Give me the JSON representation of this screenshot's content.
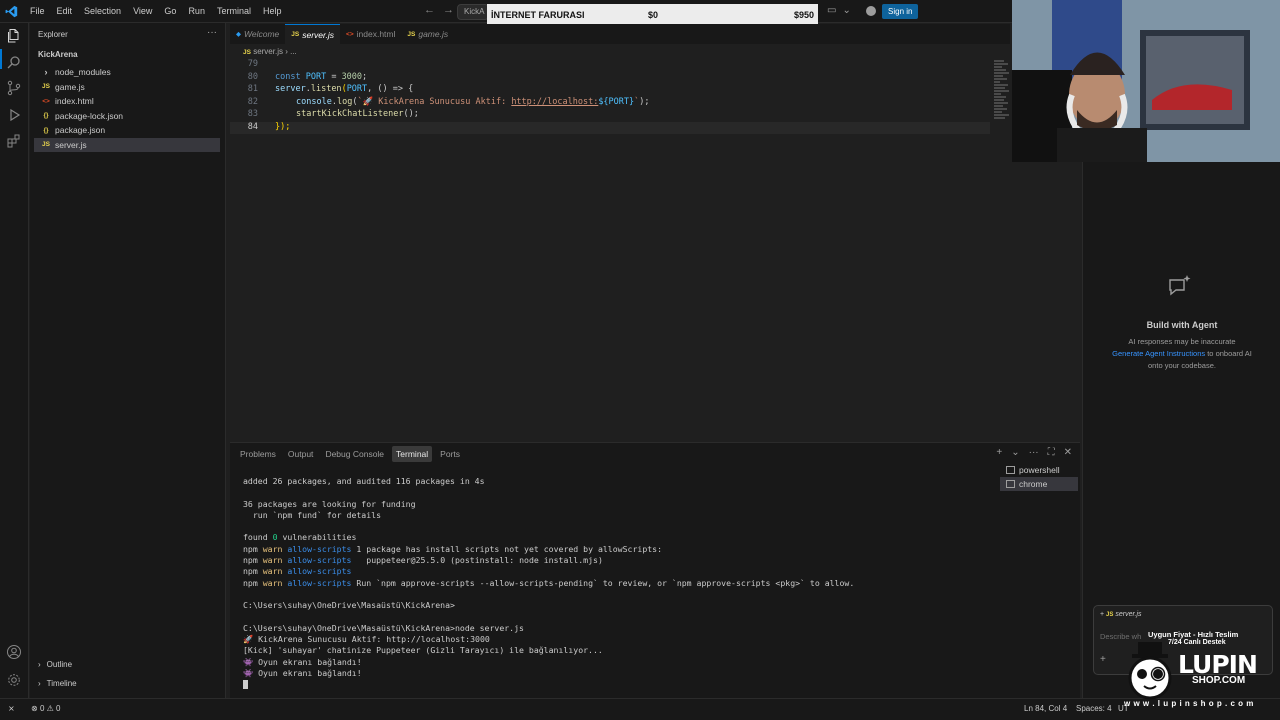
{
  "menu": [
    "File",
    "Edit",
    "Selection",
    "View",
    "Go",
    "Run",
    "Terminal",
    "Help"
  ],
  "command_center": "KickA",
  "overlay": {
    "label": "İNTERNET FARURASI",
    "current": "$0",
    "goal": "$950"
  },
  "signin_label": "Sign in",
  "sidebar": {
    "title": "Explorer",
    "folder": "KickArena",
    "items": [
      {
        "label": "node_modules",
        "icon": "chevron",
        "color": "#cccccc"
      },
      {
        "label": "game.js",
        "icon": "JS",
        "color": "#e8d44d"
      },
      {
        "label": "index.html",
        "icon": "<>",
        "color": "#e44d26"
      },
      {
        "label": "package-lock.json",
        "icon": "{}",
        "color": "#e8d44d"
      },
      {
        "label": "package.json",
        "icon": "{}",
        "color": "#e8d44d"
      },
      {
        "label": "server.js",
        "icon": "JS",
        "color": "#e8d44d"
      }
    ],
    "outline": "Outline",
    "timeline": "Timeline"
  },
  "tabs": [
    {
      "label": "Welcome",
      "icon": "vscode"
    },
    {
      "label": "server.js",
      "icon": "JS"
    },
    {
      "label": "index.html",
      "icon": "<>"
    },
    {
      "label": "game.js",
      "icon": "JS"
    }
  ],
  "breadcrumb": [
    "server.js",
    "..."
  ],
  "code": {
    "line_numbers": [
      "79",
      "80",
      "81",
      "82",
      "83",
      "84"
    ],
    "l80": {
      "kw": "const",
      "var": "PORT",
      "op": " = ",
      "num": "3000",
      "end": ";"
    },
    "l81": {
      "obj": "server",
      "fn": "listen",
      "open": "(",
      "arg": "PORT",
      "rest": ", () => {"
    },
    "l82": {
      "obj": "console",
      "fn": "log",
      "str1": "`🚀 KickArena Sunucusu Aktif: ",
      "link": "http://localhost:",
      "tpl": "${PORT}",
      "str2": "`",
      "end": ");"
    },
    "l83": {
      "fn": "startKickChatListener",
      "end": "();"
    },
    "l84": {
      "text": "});"
    }
  },
  "panel": {
    "tabs": [
      "Problems",
      "Output",
      "Debug Console",
      "Terminal",
      "Ports"
    ],
    "active_tab": "Terminal",
    "terminals": [
      "powershell",
      "chrome"
    ]
  },
  "terminal": {
    "l1": "added 26 packages, and audited 116 packages in 4s",
    "l2": "36 packages are looking for funding",
    "l3": "  run `npm fund` for details",
    "l4a": "found ",
    "l4b": "0",
    "l4c": " vulnerabilities",
    "npm": "npm",
    "warn": "warn",
    "allow": "allow-scripts",
    "w1": " 1 package has install scripts not yet covered by allowScripts:",
    "w2": "   puppeteer@25.5.0 (postinstall: node install.mjs)",
    "w3": "",
    "w4": " Run `npm approve-scripts --allow-scripts-pending` to review, or `npm approve-scripts <pkg>` to allow.",
    "p1": "C:\\Users\\suhay\\OneDrive\\Masaüstü\\KickArena>",
    "p2": "C:\\Users\\suhay\\OneDrive\\Masaüstü\\KickArena>node server.js",
    "o1": "🚀 KickArena Sunucusu Aktif: http://localhost:3000",
    "o2": "[Kick] 'suhayar' chatinize Puppeteer (Gizli Tarayıcı) ile bağlanılıyor...",
    "o3": "👾 Oyun ekranı bağlandı!",
    "o4": "👾 Oyun ekranı bağlandı!"
  },
  "chat": {
    "title": "Build with Agent",
    "line1": "AI responses may be inaccurate",
    "link": "Generate Agent Instructions",
    "line2_rest": " to onboard AI",
    "line3": "onto your codebase.",
    "chip": "server.js",
    "placeholder": "Describe wh"
  },
  "status": {
    "errors": "0",
    "warnings": "0",
    "position": "Ln 84, Col 4",
    "spaces": "Spaces: 4",
    "encoding": "UT"
  },
  "logo": {
    "tagline": "Uygun Fiyat - Hızlı Teslim",
    "tagline2": "7/24 Canlı Destek",
    "word": "LUPIN",
    "shop": "SHOP.COM",
    "url": "w w w . l u p i n s h o p . c o m"
  },
  "colors": {
    "accent": "#0078d4",
    "signin": "#0e639c",
    "link": "#3794ff"
  }
}
